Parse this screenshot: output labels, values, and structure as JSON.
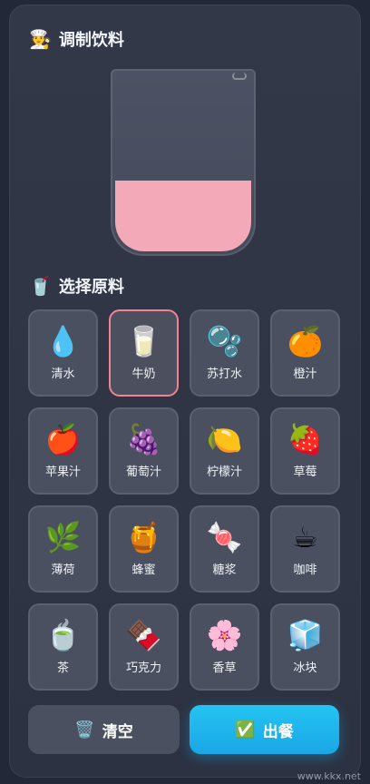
{
  "header": {
    "emoji": "🧑‍🍳",
    "title": "调制饮料"
  },
  "ingredients_section": {
    "emoji": "🥤",
    "title": "选择原料"
  },
  "colors": {
    "liquid": "#f4a9b8",
    "selected_border": "#f08494",
    "serve_button": "#1ba6e6"
  },
  "ingredients": [
    {
      "icon": "💧",
      "label": "清水",
      "selected": false
    },
    {
      "icon": "🥛",
      "label": "牛奶",
      "selected": true
    },
    {
      "icon": "🫧",
      "label": "苏打水",
      "selected": false
    },
    {
      "icon": "🍊",
      "label": "橙汁",
      "selected": false
    },
    {
      "icon": "🍎",
      "label": "苹果汁",
      "selected": false
    },
    {
      "icon": "🍇",
      "label": "葡萄汁",
      "selected": false
    },
    {
      "icon": "🍋",
      "label": "柠檬汁",
      "selected": false
    },
    {
      "icon": "🍓",
      "label": "草莓",
      "selected": false
    },
    {
      "icon": "🌿",
      "label": "薄荷",
      "selected": false
    },
    {
      "icon": "🍯",
      "label": "蜂蜜",
      "selected": false
    },
    {
      "icon": "🍬",
      "label": "糖浆",
      "selected": false
    },
    {
      "icon": "☕",
      "label": "咖啡",
      "selected": false
    },
    {
      "icon": "🍵",
      "label": "茶",
      "selected": false
    },
    {
      "icon": "🍫",
      "label": "巧克力",
      "selected": false
    },
    {
      "icon": "🌸",
      "label": "香草",
      "selected": false
    },
    {
      "icon": "🧊",
      "label": "冰块",
      "selected": false
    }
  ],
  "actions": {
    "clear": {
      "icon": "🗑️",
      "label": "清空"
    },
    "serve": {
      "icon": "✅",
      "label": "出餐"
    }
  },
  "watermark": "www.kkx.net"
}
